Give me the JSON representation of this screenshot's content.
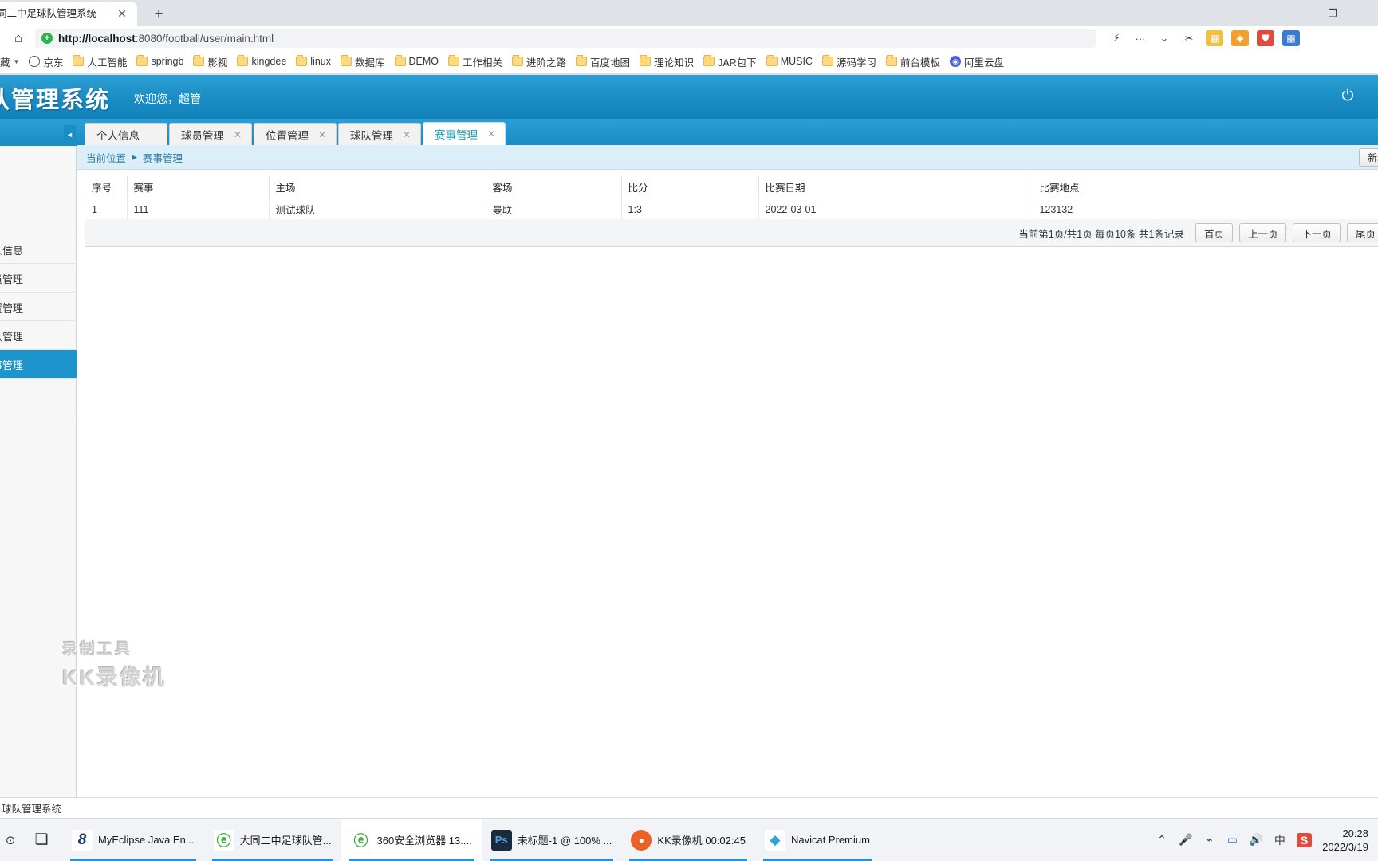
{
  "browser": {
    "tab": {
      "title": "同二中足球队管理系统",
      "close_label": "✕"
    },
    "new_tab_label": "+",
    "window_controls": [
      {
        "name": "restore",
        "glyph": "❐"
      },
      {
        "name": "minimize",
        "glyph": "—"
      }
    ],
    "home_icon": "⌂",
    "url": {
      "protocol_host": "http://localhost",
      "rest": ":8080/football/user/main.html",
      "full": "http://localhost:8080/football/user/main.html"
    },
    "shield_glyph": "✛",
    "omni_actions": [
      {
        "name": "lightning-icon",
        "glyph": "⚡"
      },
      {
        "name": "more-icon",
        "glyph": "···"
      },
      {
        "name": "chevron-down-icon",
        "glyph": "⌄"
      }
    ],
    "toolbar_icons": [
      {
        "name": "scissors-icon",
        "glyph": "✂",
        "color": "#ffffff",
        "fg": "#333333"
      },
      {
        "name": "grid-icon",
        "glyph": "▦",
        "color": "#f0c040",
        "fg": "#ffffff"
      },
      {
        "name": "shield-guard-icon",
        "glyph": "◈",
        "color": "#f0a030",
        "fg": "#ffffff"
      },
      {
        "name": "gamepad-icon",
        "glyph": "⛊",
        "color": "#e04a3f",
        "fg": "#ffffff"
      },
      {
        "name": "apps-icon",
        "glyph": "▩",
        "color": "#3a7bd5",
        "fg": "#ffffff"
      }
    ],
    "bookmarks": [
      {
        "label": "藏",
        "icon": "text"
      },
      {
        "label": "",
        "icon": "caret"
      },
      {
        "label": "京东",
        "icon": "globe"
      },
      {
        "label": "人工智能",
        "icon": "folder"
      },
      {
        "label": "springb",
        "icon": "folder"
      },
      {
        "label": "影视",
        "icon": "folder"
      },
      {
        "label": "kingdee",
        "icon": "folder"
      },
      {
        "label": "linux",
        "icon": "folder"
      },
      {
        "label": "数据库",
        "icon": "folder"
      },
      {
        "label": "DEMO",
        "icon": "folder"
      },
      {
        "label": "工作相关",
        "icon": "folder"
      },
      {
        "label": "进阶之路",
        "icon": "folder"
      },
      {
        "label": "百度地图",
        "icon": "folder"
      },
      {
        "label": "理论知识",
        "icon": "folder"
      },
      {
        "label": "JAR包下",
        "icon": "folder"
      },
      {
        "label": "MUSIC",
        "icon": "folder"
      },
      {
        "label": "源码学习",
        "icon": "folder"
      },
      {
        "label": "前台模板",
        "icon": "folder"
      },
      {
        "label": "阿里云盘",
        "icon": "blue"
      }
    ]
  },
  "app": {
    "logo_text": "球队管理系统",
    "welcome": "欢迎您，超管",
    "power_glyph": "⏻",
    "accent_color": "#1a8cc4",
    "active_tab_color": "#1296a8"
  },
  "sidebar": {
    "collapse_glyph": "◄",
    "items": [
      {
        "label": "人信息",
        "active": false
      },
      {
        "label": "员管理",
        "active": false
      },
      {
        "label": "置管理",
        "active": false
      },
      {
        "label": "队管理",
        "active": false
      },
      {
        "label": "事管理",
        "active": true
      }
    ]
  },
  "tabs": [
    {
      "label": "个人信息",
      "closable": false,
      "active": false
    },
    {
      "label": "球员管理",
      "closable": true,
      "active": false
    },
    {
      "label": "位置管理",
      "closable": true,
      "active": false
    },
    {
      "label": "球队管理",
      "closable": true,
      "active": false
    },
    {
      "label": "赛事管理",
      "closable": true,
      "active": true
    }
  ],
  "tab_close_glyph": "✕",
  "breadcrumb": {
    "label": "当前位置",
    "arrow": "▶",
    "current": "赛事管理",
    "action_button": "新增"
  },
  "table": {
    "columns": [
      "序号",
      "赛事",
      "主场",
      "客场",
      "比分",
      "比赛日期",
      "比赛地点"
    ],
    "rows": [
      [
        "1",
        "111",
        "测试球队",
        "曼联",
        "1:3",
        "2022-03-01",
        "123132"
      ]
    ]
  },
  "pagination": {
    "info": "当前第1页/共1页  每页10条  共1条记录",
    "buttons": [
      "首页",
      "上一页",
      "下一页",
      "尾页"
    ]
  },
  "watermark": {
    "top": "录制工具",
    "main": "KK录像机"
  },
  "status_bar": {
    "text": "球队管理系统"
  },
  "taskbar": {
    "start_glyph": "⊙",
    "taskview_glyph": "❏",
    "items": [
      {
        "label": "MyEclipse Java En...",
        "icon_glyph": "8",
        "icon_color": "#1b3a6b",
        "active": false
      },
      {
        "label": "大同二中足球队管...",
        "icon_glyph": "e",
        "icon_color": "#3faa3f",
        "active": false
      },
      {
        "label": "360安全浏览器 13....",
        "icon_glyph": "e",
        "icon_color": "#3faa3f",
        "active": true
      },
      {
        "label": "未标题-1 @ 100% ...",
        "icon_glyph": "Ps",
        "icon_color": "#1a2a3a",
        "active": false
      },
      {
        "label": "KK录像机 00:02:45",
        "icon_glyph": "●",
        "icon_color": "#e8622a",
        "active": false
      },
      {
        "label": "Navicat Premium",
        "icon_glyph": "◆",
        "icon_color": "#2aa5d6",
        "active": false
      }
    ],
    "tray": [
      {
        "name": "chevron-up-icon",
        "glyph": "⌃"
      },
      {
        "name": "microphone-icon",
        "glyph": "🎤"
      },
      {
        "name": "network-icon",
        "glyph": "⌁"
      },
      {
        "name": "monitor-icon",
        "glyph": "▭"
      },
      {
        "name": "volume-icon",
        "glyph": "◀))"
      },
      {
        "name": "ime-icon",
        "glyph": "中"
      },
      {
        "name": "sogou-icon",
        "glyph": "S"
      }
    ],
    "clock": {
      "time": "20:28",
      "date": "2022/3/19"
    }
  }
}
